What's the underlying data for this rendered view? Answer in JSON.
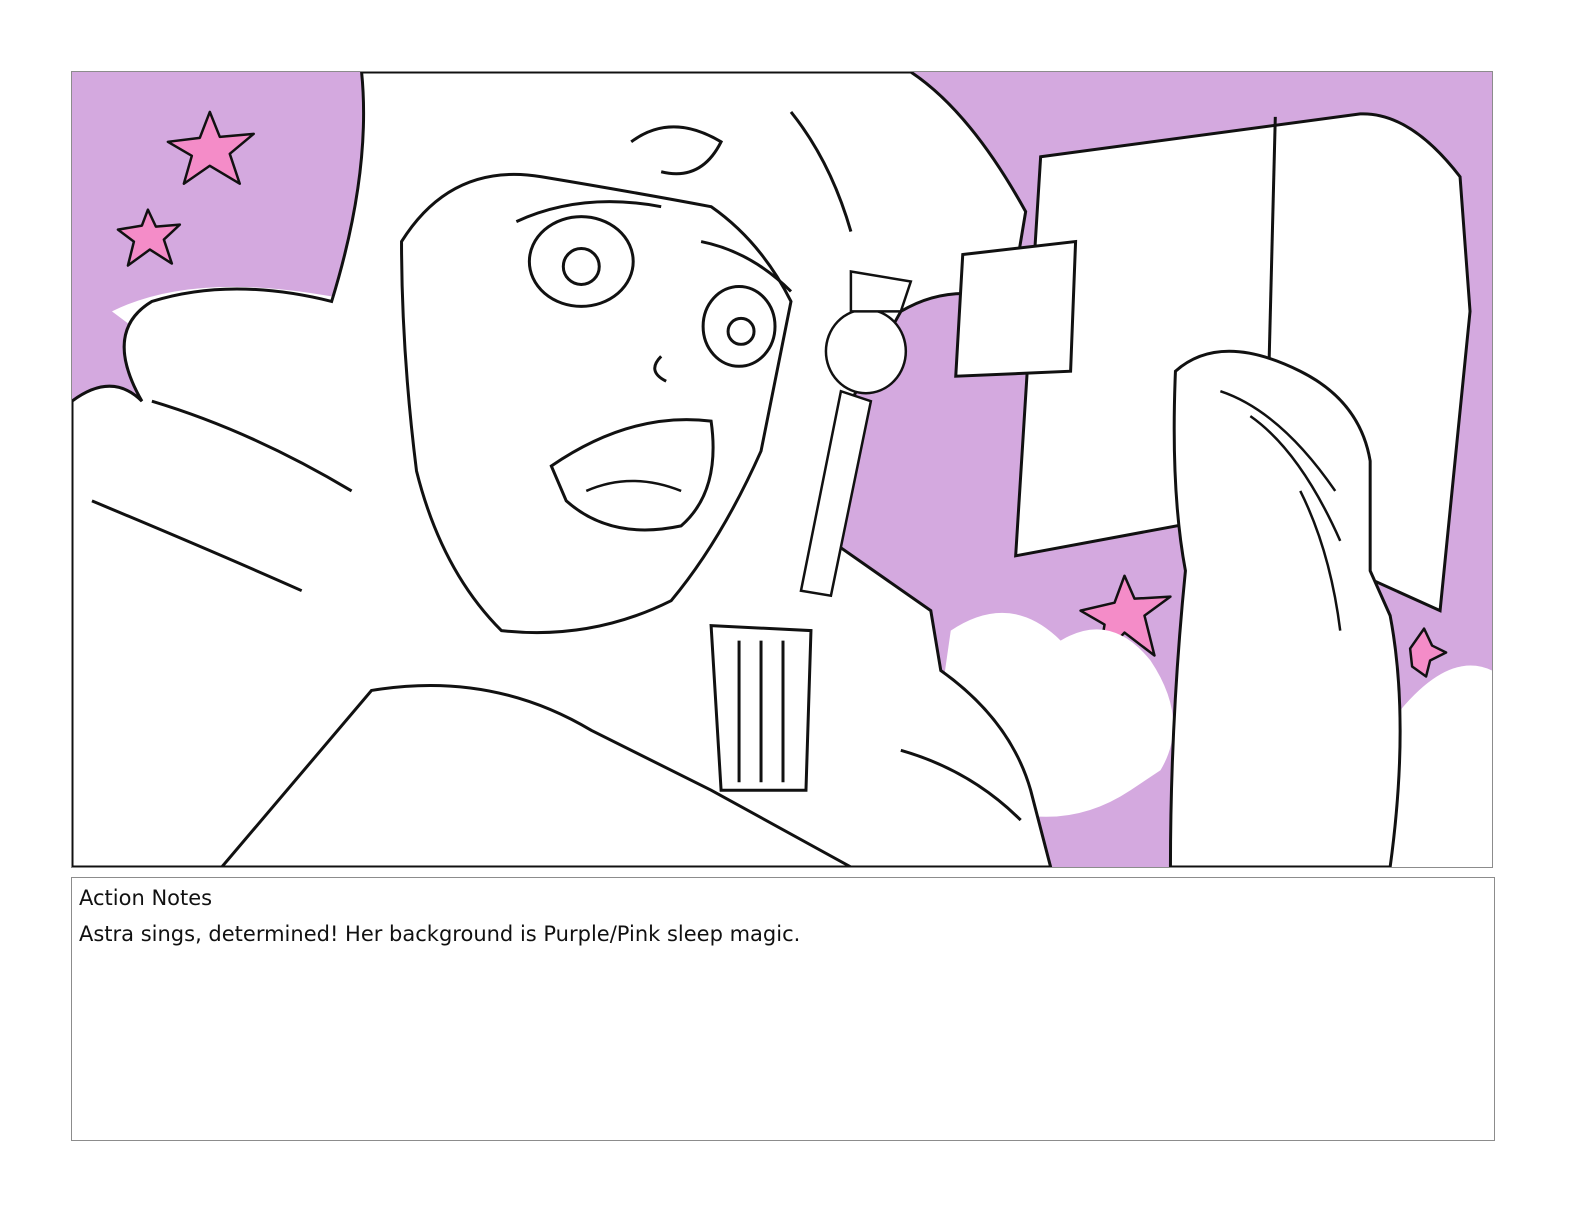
{
  "panel": {
    "background_color": "#d4a9df",
    "star_color": "#f48cc8",
    "line_color": "#111111"
  },
  "notes": {
    "heading": "Action Notes",
    "body": "Astra sings, determined!  Her background is Purple/Pink sleep magic."
  }
}
